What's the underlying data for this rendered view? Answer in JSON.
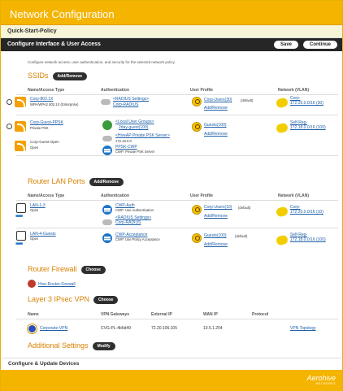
{
  "header": {
    "title": "Network Configuration"
  },
  "quickstart": {
    "label": "Quick-Start-Policy"
  },
  "configure": {
    "title": "Configure Interface & User Access",
    "save_label": "Save",
    "continue_label": "Continue"
  },
  "intro": "Configure network access, user authentication, and security for the selected network policy.",
  "ssids": {
    "title": "SSIDs",
    "add_label": "Add/Remove",
    "cols": [
      "Name/Access Type",
      "Authentication",
      "User Profile",
      "Network (VLAN)"
    ],
    "rows": [
      {
        "name": "Corp-802.1X",
        "access": "WPA/WPA2 802.1X (Enterprise)",
        "auth1": "<RADIUS Settings>",
        "auth2": "Corp-RADIUS",
        "profile": "Corp-Users(30)",
        "profile_note": "(default)",
        "add": "Add/Remove",
        "net1": "Corp-",
        "net2": "172.20.0.0/16 (30)"
      },
      {
        "name": "Corp-Guest-PPSK",
        "access": "Private PSK",
        "auth1": "<Local User Groups>",
        "auth2": "2day-guest(100)",
        "auth3": "<HiveAP Private PSK Server>",
        "auth4": "172.18.0.0",
        "auth5": "PPSK-CWP",
        "auth6": "CWP: Private PSK Server",
        "profile": "Guests(100)",
        "profile_note": "(default)",
        "add": "Add/Remove",
        "net1": "Self-Reg-",
        "net2": "172.18.0.0/16 (100)"
      },
      {
        "name": "Corp-Guest-Open",
        "access": "Open"
      }
    ]
  },
  "lanports": {
    "title": "Router LAN Ports",
    "add_label": "Add/Remove",
    "cols": [
      "Name/Access Type",
      "Authentication",
      "User Profile",
      "Network (VLAN)"
    ],
    "rows": [
      {
        "name": "LAN-1-3",
        "access": "Open",
        "auth1": "CWP-Auth",
        "auth2": "CWP: Use Authentication",
        "auth3": "<RADIUS Settings>",
        "auth4": "Corp-RADIUS",
        "profile": "Corp-Users(10)",
        "profile_note": "(default)",
        "add": "Add/Remove",
        "net1": "Corp-",
        "net2": "172.20.0.0/16 (10)"
      },
      {
        "name": "LAN-4-Guests",
        "access": "Open",
        "auth1": "CWP-Acceptance",
        "auth2": "CWP: Use Policy Acceptance",
        "profile": "Guests(100)",
        "profile_note": "(default)",
        "add": "Add/Remove",
        "net1": "Self-Reg-",
        "net2": "172.18.0.0/16 (100)"
      }
    ]
  },
  "firewall": {
    "title": "Router Firewall",
    "choose_label": "Choose",
    "item": "Hive-Router-Firewall"
  },
  "vpn": {
    "title": "Layer 3 IPsec VPN",
    "choose_label": "Choose",
    "cols": [
      "Name",
      "VPN Gateways",
      "External IP",
      "WAN IP",
      "Protocol"
    ],
    "row": {
      "name": "Corporate-VPN",
      "gateway": "CVG-PL-4b6d49",
      "external": "72.20.106.105",
      "wan": "10.5.1.254",
      "protocol": "",
      "topology": "VPN Topology"
    }
  },
  "additional": {
    "title": "Additional Settings",
    "modify_label": "Modify"
  },
  "footer": {
    "update_label": "Configure & Update Devices",
    "logo": "Aerohive",
    "logo_sub": "NETWORKS"
  },
  "colors": {
    "accent": "#f5b400",
    "link": "#1e5fa8",
    "section": "#d98000"
  }
}
